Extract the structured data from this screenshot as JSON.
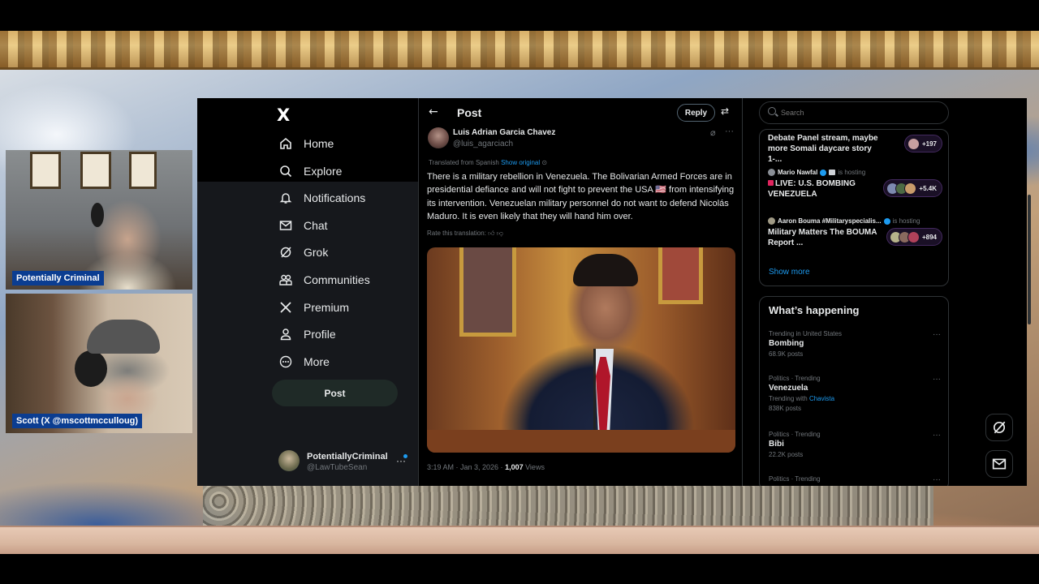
{
  "stream": {
    "cam1_label": "Potentially Criminal",
    "cam2_label": "Scott (X @mscottmcculloug)"
  },
  "nav": {
    "logo": "X",
    "items": [
      {
        "label": "Home",
        "icon": "home-icon"
      },
      {
        "label": "Explore",
        "icon": "search-icon"
      },
      {
        "label": "Notifications",
        "icon": "bell-icon"
      },
      {
        "label": "Chat",
        "icon": "envelope-icon"
      },
      {
        "label": "Grok",
        "icon": "grok-icon"
      },
      {
        "label": "Communities",
        "icon": "people-icon"
      },
      {
        "label": "Premium",
        "icon": "x-icon"
      },
      {
        "label": "Profile",
        "icon": "person-icon"
      },
      {
        "label": "More",
        "icon": "more-circle-icon"
      }
    ],
    "post_button": "Post",
    "account": {
      "name": "PotentiallyCriminal",
      "handle": "@LawTubeSean"
    }
  },
  "post_view": {
    "title": "Post",
    "reply_label": "Reply",
    "author_name": "Luis Adrian Garcia Chavez",
    "author_handle": "@luis_agarciach",
    "translated_prefix": "Translated from Spanish",
    "show_original": "Show original",
    "text": "There is a military rebellion in Venezuela. The Bolivarian Armed Forces are in presidential defiance and will not fight to prevent the USA 🇺🇸 from intensifying its intervention. Venezuelan military personnel do not want to defend Nicolás Maduro. It is even likely that they will hand him over.",
    "rate_translation": "Rate this translation:",
    "time": "3:19 AM · Jan 3, 2026 · ",
    "views_count": "1,007",
    "views_label": " Views"
  },
  "sidebar": {
    "search_placeholder": "Search",
    "spaces": [
      {
        "host": "",
        "hosting": "",
        "title": "Debate Panel stream, maybe more Somali daycare story 1-...",
        "count": "+197",
        "live": false
      },
      {
        "host": "Mario Nawfal",
        "hosting": "is hosting",
        "title": "LIVE: U.S. BOMBING VENEZUELA",
        "count": "+5.4K",
        "live": true
      },
      {
        "host": "Aaron Bouma #Militaryspecialis...",
        "hosting": "is hosting",
        "title": "Military Matters The BOUMA Report ...",
        "count": "+894",
        "live": false
      }
    ],
    "show_more": "Show more",
    "happening_title": "What’s happening",
    "trends": [
      {
        "meta": "Trending in United States",
        "name": "Bombing",
        "posts": "68.9K posts",
        "with_prefix": "",
        "with_link": ""
      },
      {
        "meta": "Politics · Trending",
        "name": "Venezuela",
        "posts": "838K posts",
        "with_prefix": "Trending with ",
        "with_link": "Chavista"
      },
      {
        "meta": "Politics · Trending",
        "name": "Bibi",
        "posts": "22.2K posts",
        "with_prefix": "",
        "with_link": ""
      },
      {
        "meta": "Politics · Trending",
        "name": "",
        "posts": "",
        "with_prefix": "",
        "with_link": ""
      }
    ]
  },
  "colors": {
    "accent": "#1d9bf0",
    "background": "#000000",
    "stream_label": "#0b3d91"
  }
}
